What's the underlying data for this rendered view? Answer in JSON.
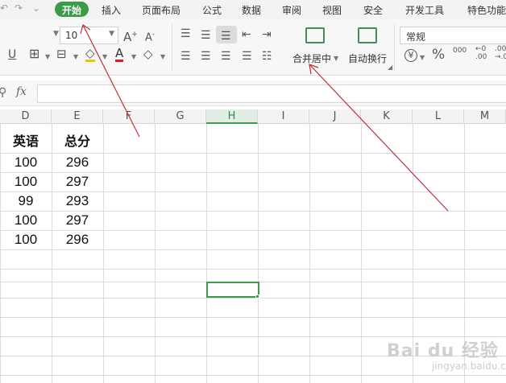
{
  "menu": {
    "tabs": [
      "开始",
      "插入",
      "页面布局",
      "公式",
      "数据",
      "审阅",
      "视图",
      "安全",
      "开发工具",
      "特色功能"
    ],
    "active": "开始"
  },
  "ribbon": {
    "font_size": "10",
    "number_format": "常规",
    "merge_center": "合并居中",
    "wrap_text": "自动换行",
    "percent": "%",
    "thousands": "000",
    "inc_decimal_top": "←0",
    "inc_decimal_bottom": ".00",
    "dec_decimal_top": ".00",
    "dec_decimal_bottom": "→.0",
    "currency": "¥"
  },
  "formula_bar": {
    "fx": "fx",
    "value": ""
  },
  "grid": {
    "columns": [
      "D",
      "E",
      "F",
      "G",
      "H",
      "I",
      "J",
      "K",
      "L",
      "M"
    ],
    "selected_column": "H",
    "header_row": [
      "英语",
      "总分"
    ],
    "rows": [
      [
        "100",
        "296"
      ],
      [
        "100",
        "297"
      ],
      [
        "99",
        "293"
      ],
      [
        "100",
        "297"
      ],
      [
        "100",
        "296"
      ]
    ]
  },
  "colors": {
    "accent": "#3a9b48",
    "arrow": "#c0303a"
  },
  "watermark": {
    "text": "Bai du 经验",
    "sub": "jingyan.baidu.com"
  }
}
